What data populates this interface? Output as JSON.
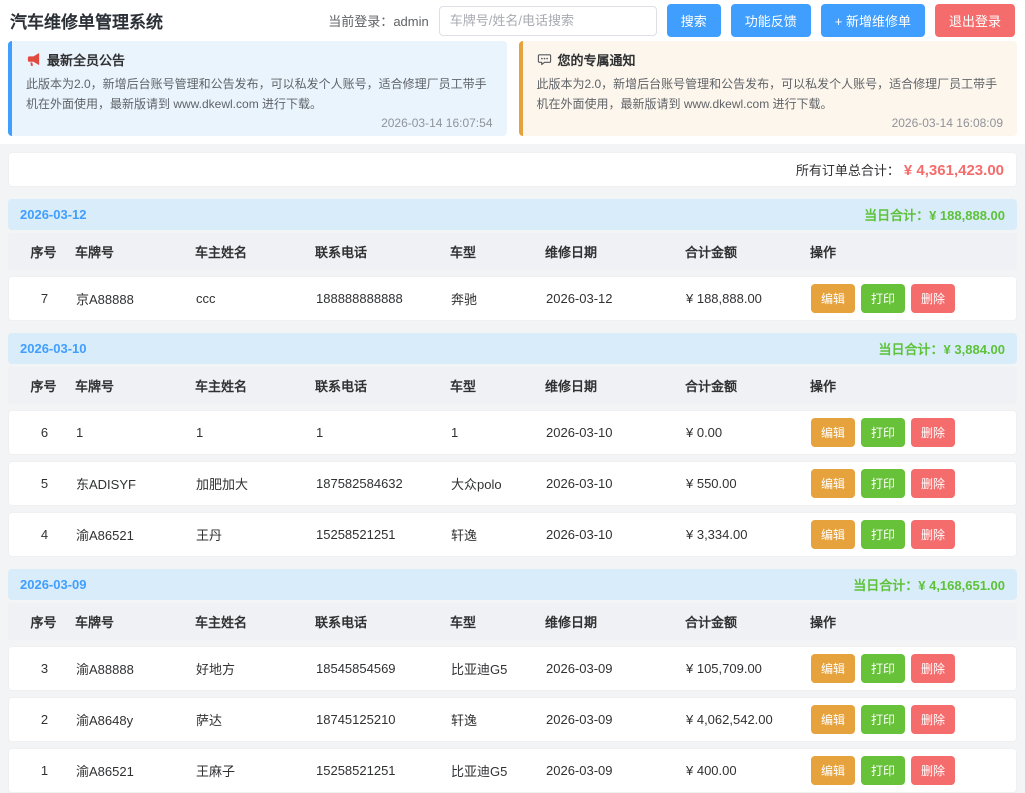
{
  "header": {
    "title": "汽车维修单管理系统",
    "login_label": "当前登录：",
    "login_user": "admin",
    "search_placeholder": "车牌号/姓名/电话搜索",
    "search_button": "搜索",
    "feedback_button": "功能反馈",
    "add_button": "+ 新增维修单",
    "logout_button": "退出登录"
  },
  "notices": {
    "announcement": {
      "icon": "megaphone-icon",
      "title": "最新全员公告",
      "body": "此版本为2.0，新增后台账号管理和公告发布，可以私发个人账号，适合修理厂员工带手机在外面使用，最新版请到 www.dkewl.com 进行下载。",
      "timestamp": "2026-03-14 16:07:54"
    },
    "personal": {
      "icon": "speech-bubble-icon",
      "title": "您的专属通知",
      "body": "此版本为2.0，新增后台账号管理和公告发布，可以私发个人账号，适合修理厂员工带手机在外面使用，最新版请到 www.dkewl.com 进行下载。",
      "timestamp": "2026-03-14 16:08:09"
    }
  },
  "summary": {
    "label": "所有订单总合计：",
    "amount": "¥ 4,361,423.00"
  },
  "table": {
    "columns": [
      "序号",
      "车牌号",
      "车主姓名",
      "联系电话",
      "车型",
      "维修日期",
      "合计金额",
      "操作"
    ],
    "daily_total_label": "当日合计：",
    "actions": {
      "edit": "编辑",
      "print": "打印",
      "delete": "删除"
    }
  },
  "sections": [
    {
      "date": "2026-03-12",
      "daily_total": "¥ 188,888.00",
      "rows": [
        {
          "seq": "7",
          "plate": "京A88888",
          "owner": "ccc",
          "phone": "188888888888",
          "model": "奔驰",
          "date": "2026-03-12",
          "amount": "¥ 188,888.00"
        }
      ]
    },
    {
      "date": "2026-03-10",
      "daily_total": "¥ 3,884.00",
      "rows": [
        {
          "seq": "6",
          "plate": "1",
          "owner": "1",
          "phone": "1",
          "model": "1",
          "date": "2026-03-10",
          "amount": "¥ 0.00"
        },
        {
          "seq": "5",
          "plate": "东ADISYF",
          "owner": "加肥加大",
          "phone": "187582584632",
          "model": "大众polo",
          "date": "2026-03-10",
          "amount": "¥ 550.00"
        },
        {
          "seq": "4",
          "plate": "渝A86521",
          "owner": "王丹",
          "phone": "15258521251",
          "model": "轩逸",
          "date": "2026-03-10",
          "amount": "¥ 3,334.00"
        }
      ]
    },
    {
      "date": "2026-03-09",
      "daily_total": "¥ 4,168,651.00",
      "rows": [
        {
          "seq": "3",
          "plate": "渝A88888",
          "owner": "好地方",
          "phone": "18545854569",
          "model": "比亚迪G5",
          "date": "2026-03-09",
          "amount": "¥ 105,709.00"
        },
        {
          "seq": "2",
          "plate": "渝A8648y",
          "owner": "萨达",
          "phone": "18745125210",
          "model": "轩逸",
          "date": "2026-03-09",
          "amount": "¥ 4,062,542.00"
        },
        {
          "seq": "1",
          "plate": "渝A86521",
          "owner": "王麻子",
          "phone": "15258521251",
          "model": "比亚迪G5",
          "date": "2026-03-09",
          "amount": "¥ 400.00"
        }
      ]
    }
  ],
  "colors": {
    "primary": "#409eff",
    "danger": "#f56c6c",
    "warning": "#e6a23c",
    "success": "#67c23a",
    "grand_total_amount": "#f56c6c",
    "daily_total_text": "#5dc239",
    "section_header_bg": "#d9ecf9",
    "notice_blue_bg": "#eaf4fd",
    "notice_orange_bg": "#fdf6ec"
  }
}
